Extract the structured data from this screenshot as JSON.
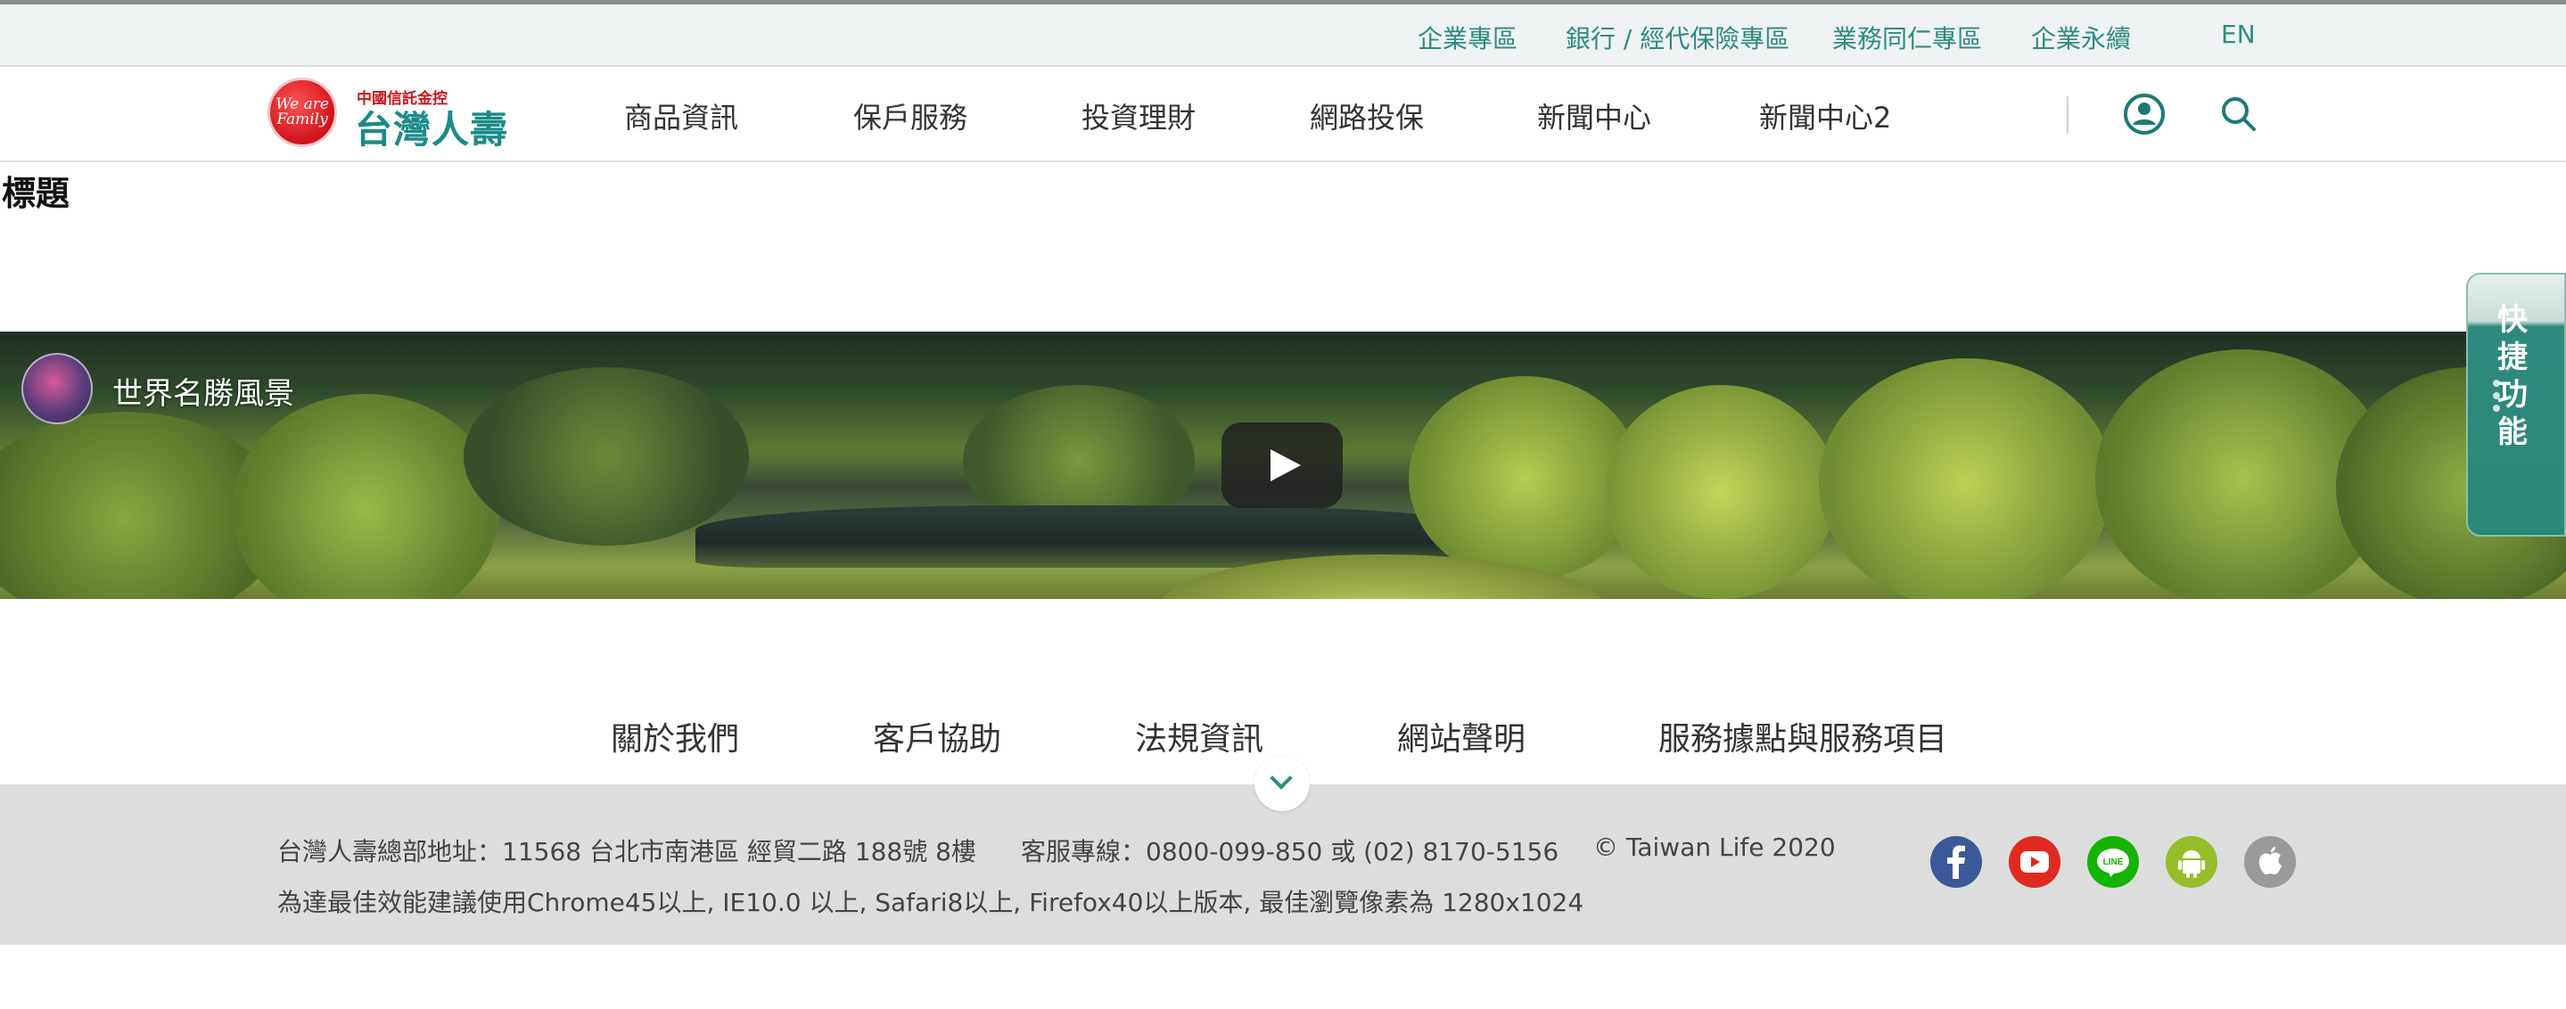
{
  "topbar": {
    "links": [
      "企業專區",
      "銀行 / 經代保險專區",
      "業務同仁專區",
      "企業永續",
      "EN"
    ]
  },
  "logo": {
    "emblem_text": "We are Family",
    "subtitle": "中國信託金控",
    "name": "台灣人壽"
  },
  "nav": {
    "items": [
      "商品資訊",
      "保戶服務",
      "投資理財",
      "網路投保",
      "新聞中心",
      "新聞中心2"
    ],
    "icons": [
      "user-icon",
      "search-icon"
    ]
  },
  "page": {
    "title": "標題"
  },
  "video": {
    "channel_title": "世界名勝風景",
    "play_icon": "play-icon"
  },
  "quick_tab": {
    "label": "快捷功能"
  },
  "footer_nav": {
    "items": [
      "關於我們",
      "客戶協助",
      "法規資訊",
      "網站聲明",
      "服務據點與服務項目"
    ]
  },
  "footer": {
    "address": "台灣人壽總部地址：11568 台北市南港區 經貿二路 188號 8樓",
    "hotline": "客服專線：0800-099-850 或 (02) 8170-5156",
    "copyright": "© Taiwan Life 2020",
    "browser_note": "為達最佳效能建議使用Chrome45以上, IE10.0 以上, Safari8以上, Firefox40以上版本, 最佳瀏覽像素為 1280x1024",
    "social": [
      "facebook-icon",
      "youtube-icon",
      "line-icon",
      "android-icon",
      "apple-icon"
    ]
  },
  "colors": {
    "accent": "#2e8b80",
    "logo_red": "#d0141c",
    "footer_bg": "#dddddd"
  }
}
